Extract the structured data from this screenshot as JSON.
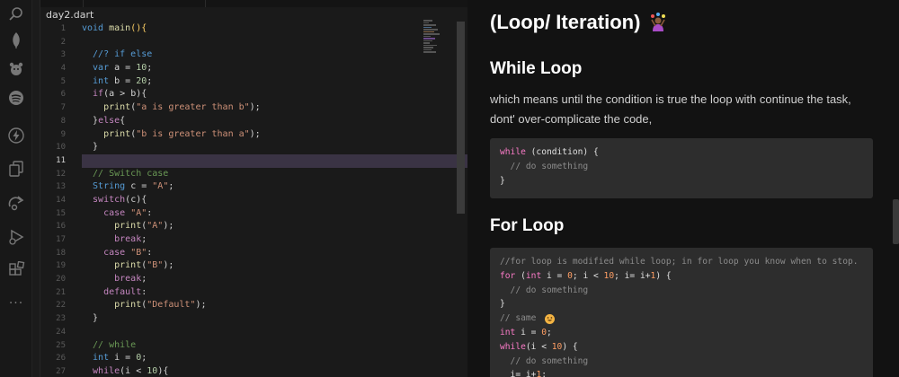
{
  "activity_bar": {
    "icons": [
      "search-icon",
      "mongodb-leaf-icon",
      "github-icon",
      "spotify-icon",
      "lightning-icon",
      "copy-icon",
      "live-share-icon",
      "run-debug-icon",
      "extensions-icon",
      "more-icon"
    ],
    "more_glyph": "···"
  },
  "editor": {
    "filename": "day2.dart",
    "active_line": 11,
    "line_numbers": [
      "1",
      "2",
      "3",
      "4",
      "5",
      "6",
      "7",
      "8",
      "9",
      "10",
      "11",
      "12",
      "13",
      "14",
      "15",
      "16",
      "17",
      "18",
      "19",
      "20",
      "21",
      "22",
      "23",
      "24",
      "25",
      "26",
      "27"
    ],
    "lines": [
      [
        {
          "t": "void ",
          "c": "kw"
        },
        {
          "t": "main",
          "c": "fn"
        },
        {
          "t": "(){",
          "c": "pbr"
        }
      ],
      [],
      [
        {
          "t": "  //? if else",
          "c": "kw"
        }
      ],
      [
        {
          "t": "  var ",
          "c": "kw"
        },
        {
          "t": "a = ",
          "c": ""
        },
        {
          "t": "10",
          "c": "num"
        },
        {
          "t": ";",
          "c": ""
        }
      ],
      [
        {
          "t": "  int ",
          "c": "kw"
        },
        {
          "t": "b = ",
          "c": ""
        },
        {
          "t": "20",
          "c": "num"
        },
        {
          "t": ";",
          "c": ""
        }
      ],
      [
        {
          "t": "  if",
          "c": "kw2"
        },
        {
          "t": "(a > b){",
          "c": ""
        }
      ],
      [
        {
          "t": "    print",
          "c": "fn"
        },
        {
          "t": "(",
          "c": ""
        },
        {
          "t": "\"a is greater than b\"",
          "c": "str"
        },
        {
          "t": ");",
          "c": ""
        }
      ],
      [
        {
          "t": "  }",
          "c": ""
        },
        {
          "t": "else",
          "c": "kw2"
        },
        {
          "t": "{",
          "c": ""
        }
      ],
      [
        {
          "t": "    print",
          "c": "fn"
        },
        {
          "t": "(",
          "c": ""
        },
        {
          "t": "\"b is greater than a\"",
          "c": "str"
        },
        {
          "t": ");",
          "c": ""
        }
      ],
      [
        {
          "t": "  }",
          "c": ""
        }
      ],
      [],
      [
        {
          "t": "  // Switch case",
          "c": "cm"
        }
      ],
      [
        {
          "t": "  String ",
          "c": "kw"
        },
        {
          "t": "c = ",
          "c": ""
        },
        {
          "t": "\"A\"",
          "c": "str"
        },
        {
          "t": ";",
          "c": ""
        }
      ],
      [
        {
          "t": "  switch",
          "c": "kw2"
        },
        {
          "t": "(c){",
          "c": ""
        }
      ],
      [
        {
          "t": "    case ",
          "c": "kw2"
        },
        {
          "t": "\"A\"",
          "c": "str"
        },
        {
          "t": ":",
          "c": ""
        }
      ],
      [
        {
          "t": "      print",
          "c": "fn"
        },
        {
          "t": "(",
          "c": ""
        },
        {
          "t": "\"A\"",
          "c": "str"
        },
        {
          "t": ");",
          "c": ""
        }
      ],
      [
        {
          "t": "      break",
          "c": "kw2"
        },
        {
          "t": ";",
          "c": ""
        }
      ],
      [
        {
          "t": "    case ",
          "c": "kw2"
        },
        {
          "t": "\"B\"",
          "c": "str"
        },
        {
          "t": ":",
          "c": ""
        }
      ],
      [
        {
          "t": "      print",
          "c": "fn"
        },
        {
          "t": "(",
          "c": ""
        },
        {
          "t": "\"B\"",
          "c": "str"
        },
        {
          "t": ");",
          "c": ""
        }
      ],
      [
        {
          "t": "      break",
          "c": "kw2"
        },
        {
          "t": ";",
          "c": ""
        }
      ],
      [
        {
          "t": "    default",
          "c": "kw2"
        },
        {
          "t": ":",
          "c": ""
        }
      ],
      [
        {
          "t": "      print",
          "c": "fn"
        },
        {
          "t": "(",
          "c": ""
        },
        {
          "t": "\"Default\"",
          "c": "str"
        },
        {
          "t": ");",
          "c": ""
        }
      ],
      [
        {
          "t": "  }",
          "c": ""
        }
      ],
      [],
      [
        {
          "t": "  // while",
          "c": "cm"
        }
      ],
      [
        {
          "t": "  int ",
          "c": "kw"
        },
        {
          "t": "i = ",
          "c": ""
        },
        {
          "t": "0",
          "c": "num"
        },
        {
          "t": ";",
          "c": ""
        }
      ],
      [
        {
          "t": "  while",
          "c": "kw2"
        },
        {
          "t": "(i < ",
          "c": ""
        },
        {
          "t": "10",
          "c": "num"
        },
        {
          "t": "){",
          "c": ""
        }
      ]
    ]
  },
  "preview": {
    "title": "(Loop/ Iteration)",
    "while_heading": "While Loop",
    "while_para": "which means until the condition is true the loop with continue the task, dont' over-complicate the code,",
    "while_code": [
      [
        {
          "t": "while ",
          "c": "pkw"
        },
        {
          "t": "(condition) {",
          "c": "pvar"
        }
      ],
      [
        {
          "t": "  // do something",
          "c": "pcm"
        }
      ],
      [
        {
          "t": "}",
          "c": "pvar"
        }
      ]
    ],
    "for_heading": "For Loop",
    "for_code": [
      [
        {
          "t": "//for loop is modified while loop; in for loop you know when to stop.",
          "c": "pcm"
        }
      ],
      [
        {
          "t": "for ",
          "c": "pkw"
        },
        {
          "t": "(",
          "c": "pvar"
        },
        {
          "t": "int ",
          "c": "pkw"
        },
        {
          "t": "i = ",
          "c": "pvar"
        },
        {
          "t": "0",
          "c": "pnum"
        },
        {
          "t": "; i < ",
          "c": "pvar"
        },
        {
          "t": "10",
          "c": "pnum"
        },
        {
          "t": "; i= i+",
          "c": "pvar"
        },
        {
          "t": "1",
          "c": "pnum"
        },
        {
          "t": ") {",
          "c": "pvar"
        }
      ],
      [
        {
          "t": "  // do something",
          "c": "pcm"
        }
      ],
      [
        {
          "t": "}",
          "c": "pvar"
        }
      ],
      [
        {
          "t": "// same ",
          "c": "pcm"
        },
        {
          "face": true
        }
      ],
      [
        {
          "t": "int ",
          "c": "pkw"
        },
        {
          "t": "i = ",
          "c": "pvar"
        },
        {
          "t": "0",
          "c": "pnum"
        },
        {
          "t": ";",
          "c": "pvar"
        }
      ],
      [
        {
          "t": "while",
          "c": "pkw"
        },
        {
          "t": "(i < ",
          "c": "pvar"
        },
        {
          "t": "10",
          "c": "pnum"
        },
        {
          "t": ") {",
          "c": "pvar"
        }
      ],
      [
        {
          "t": "  // do something",
          "c": "pcm"
        }
      ],
      [
        {
          "t": "  i= i+",
          "c": "pvar"
        },
        {
          "t": "1",
          "c": "pnum"
        },
        {
          "t": ";",
          "c": "pvar"
        }
      ]
    ]
  }
}
